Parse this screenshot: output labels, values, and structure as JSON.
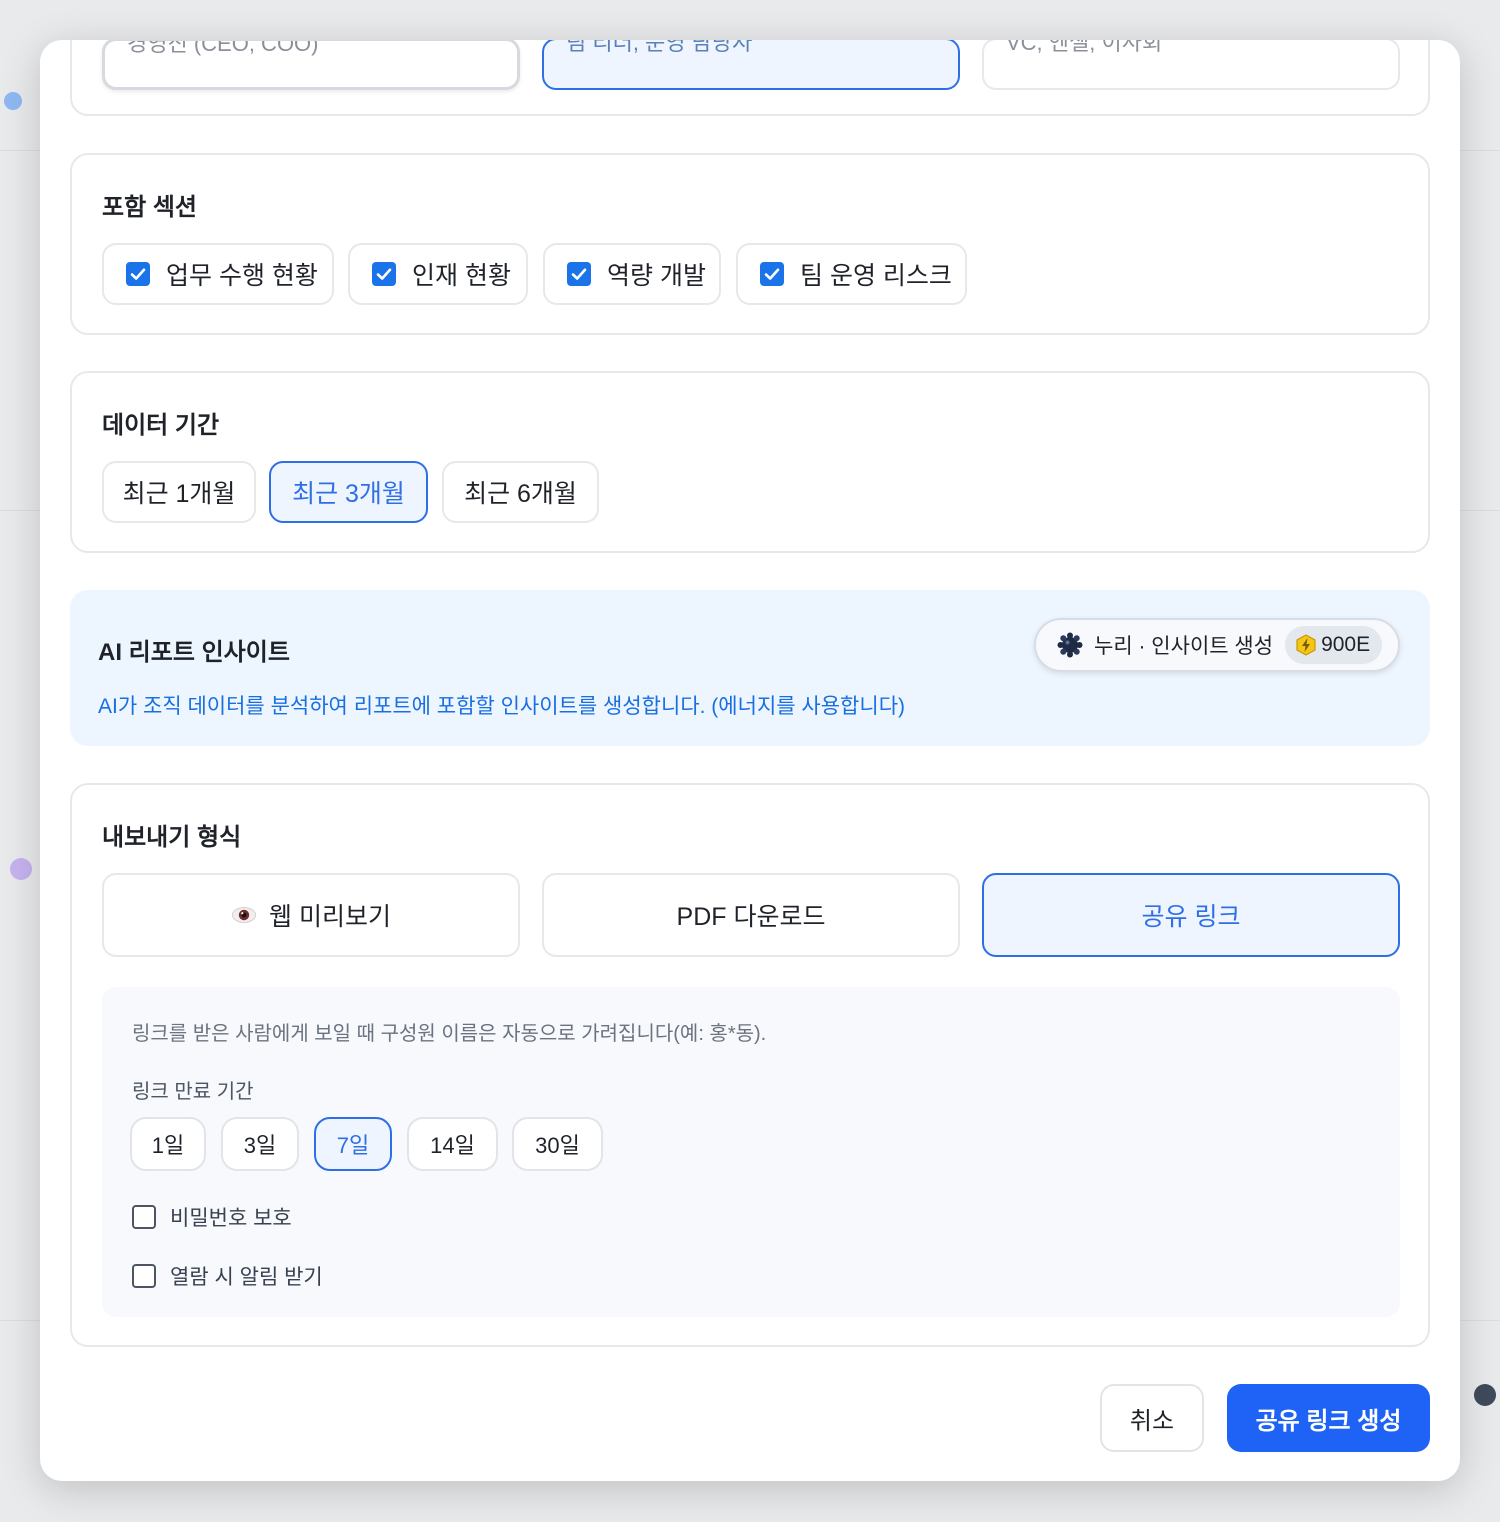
{
  "audience": {
    "options": [
      {
        "label": "경영진 (CEO, COO)",
        "selected": false
      },
      {
        "label": "팀 리더, 운영 담당자",
        "selected": true
      },
      {
        "label": "VC, 엔젤, 이사회",
        "selected": false
      }
    ]
  },
  "sections": {
    "title": "포함 섹션",
    "items": [
      {
        "label": "업무 수행 현황",
        "checked": true
      },
      {
        "label": "인재 현황",
        "checked": true
      },
      {
        "label": "역량 개발",
        "checked": true
      },
      {
        "label": "팀 운영 리스크",
        "checked": true
      }
    ]
  },
  "period": {
    "title": "데이터 기간",
    "options": [
      {
        "label": "최근 1개월",
        "selected": false
      },
      {
        "label": "최근 3개월",
        "selected": true
      },
      {
        "label": "최근 6개월",
        "selected": false
      }
    ]
  },
  "ai": {
    "title": "AI 리포트 인사이트",
    "description": "AI가 조직 데이터를 분석하여 리포트에 포함할 인사이트를 생성합니다. (에너지를 사용합니다)",
    "button_label": "누리 · 인사이트 생성",
    "energy_cost": "900E"
  },
  "export": {
    "title": "내보내기 형식",
    "formats": [
      {
        "label": "웹 미리보기",
        "icon": "eye-icon",
        "selected": false
      },
      {
        "label": "PDF 다운로드",
        "selected": false
      },
      {
        "label": "공유 링크",
        "selected": true
      }
    ],
    "notice": "링크를 받은 사람에게 보일 때 구성원 이름은 자동으로 가려집니다(예: 홍*동).",
    "expiry_label": "링크 만료 기간",
    "expiry_options": [
      {
        "label": "1일",
        "selected": false
      },
      {
        "label": "3일",
        "selected": false
      },
      {
        "label": "7일",
        "selected": true
      },
      {
        "label": "14일",
        "selected": false
      },
      {
        "label": "30일",
        "selected": false
      }
    ],
    "password_label": "비밀번호 보호",
    "password_checked": false,
    "notify_label": "열람 시 알림 받기",
    "notify_checked": false
  },
  "footer": {
    "cancel_label": "취소",
    "create_label": "공유 링크 생성"
  },
  "colors": {
    "accent": "#1e63f5",
    "selected_border": "#2f6fe6",
    "selected_bg": "#eef5ff",
    "ai_panel_bg": "#edf5ff",
    "energy_icon": "#f5c518"
  }
}
